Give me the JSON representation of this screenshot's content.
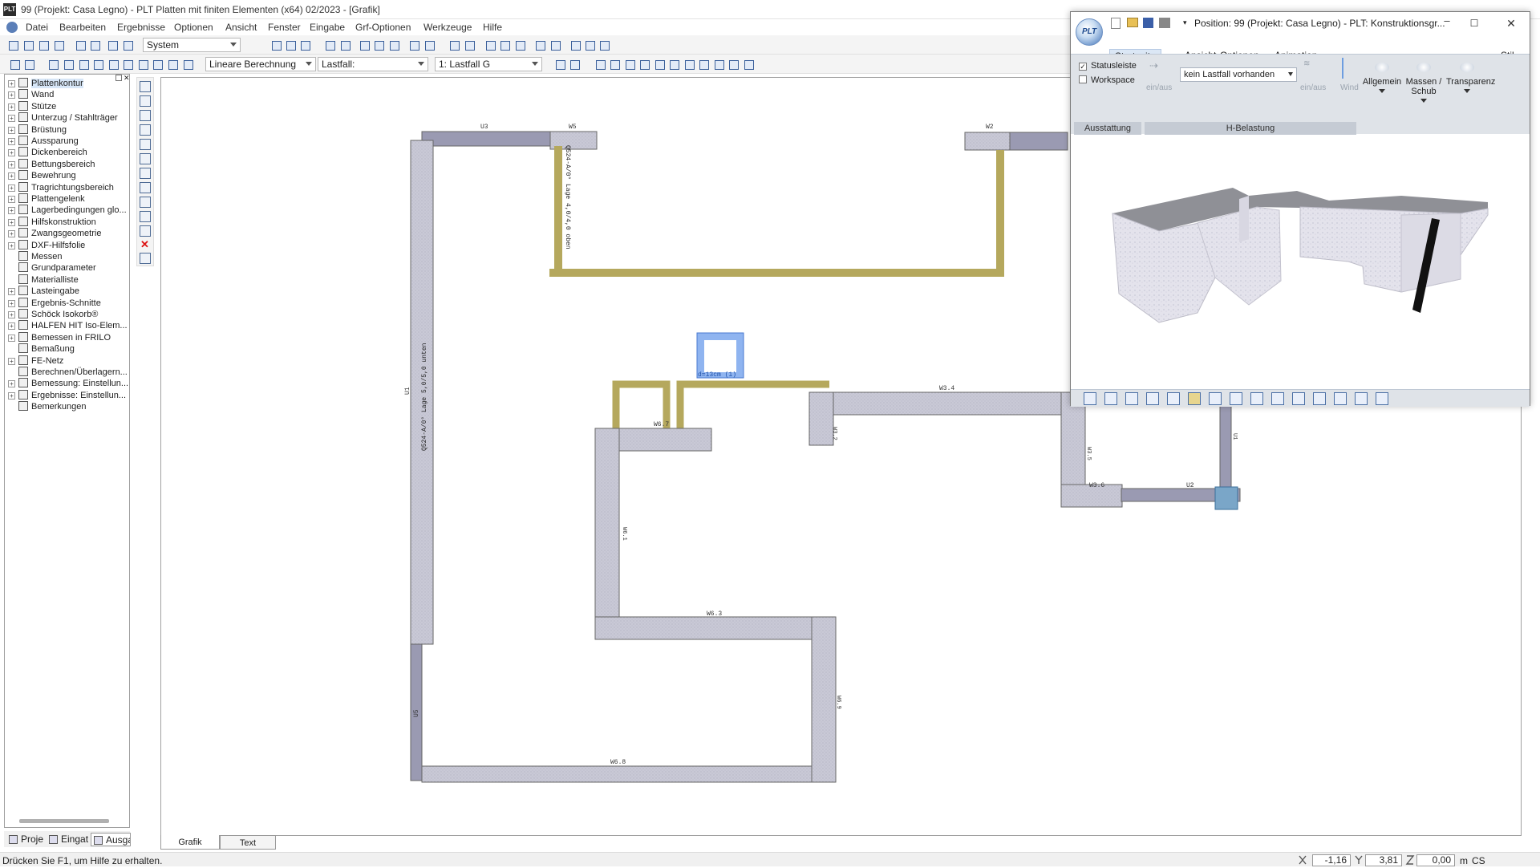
{
  "window": {
    "app_icon": "PLT",
    "title": "99 (Projekt: Casa Legno) - PLT Platten mit finiten Elementen (x64) 02/2023 - [Grafik]"
  },
  "menu": [
    "Datei",
    "Bearbeiten",
    "Ergebnisse",
    "Optionen",
    "Ansicht",
    "Fenster",
    "Eingabe",
    "Grf-Optionen",
    "Werkzeuge",
    "Hilfe"
  ],
  "toolbar1": {
    "system_combo": "System"
  },
  "toolbar2": {
    "calc_combo": "Lineare Berechnung",
    "lastfall_label": "Lastfall:",
    "lastfall_combo": "1: Lastfall G"
  },
  "tree": {
    "items": [
      {
        "label": "Plattenkontur",
        "expandable": true,
        "selected": true
      },
      {
        "label": "Wand",
        "expandable": true
      },
      {
        "label": "Stütze",
        "expandable": true
      },
      {
        "label": "Unterzug / Stahlträger",
        "expandable": true
      },
      {
        "label": "Brüstung",
        "expandable": true
      },
      {
        "label": "Aussparung",
        "expandable": true
      },
      {
        "label": "Dickenbereich",
        "expandable": true
      },
      {
        "label": "Bettungsbereich",
        "expandable": true
      },
      {
        "label": "Bewehrung",
        "expandable": true
      },
      {
        "label": "Tragrichtungsbereich",
        "expandable": true
      },
      {
        "label": "Plattengelenk",
        "expandable": true
      },
      {
        "label": "Lagerbedingungen glo...",
        "expandable": true
      },
      {
        "label": "Hilfskonstruktion",
        "expandable": true
      },
      {
        "label": "Zwangsgeometrie",
        "expandable": true
      },
      {
        "label": "DXF-Hilfsfolie",
        "expandable": true
      },
      {
        "label": "Messen",
        "expandable": false
      },
      {
        "label": "Grundparameter",
        "expandable": false
      },
      {
        "label": "Materialliste",
        "expandable": false
      },
      {
        "label": "Lasteingabe",
        "expandable": true
      },
      {
        "label": "Ergebnis-Schnitte",
        "expandable": true
      },
      {
        "label": "Schöck Isokorb®",
        "expandable": true
      },
      {
        "label": "HALFEN HIT Iso-Elem...",
        "expandable": true
      },
      {
        "label": "Bemessen in FRILO",
        "expandable": true
      },
      {
        "label": "Bemaßung",
        "expandable": false
      },
      {
        "label": "FE-Netz",
        "expandable": true
      },
      {
        "label": "Berechnen/Überlagern...",
        "expandable": false
      },
      {
        "label": "Bemessung: Einstellun...",
        "expandable": true
      },
      {
        "label": "Ergebnisse: Einstellun...",
        "expandable": true
      },
      {
        "label": "Bemerkungen",
        "expandable": false
      }
    ],
    "tabs": [
      "Proje",
      "Eingat",
      "Ausga"
    ]
  },
  "drawing": {
    "labels": {
      "u3": "U3",
      "w5": "W5",
      "w2": "W2",
      "u1": "U1",
      "u5": "U5",
      "w34": "W3.4",
      "w32": "W3.2",
      "w35": "W3.5",
      "w36": "W3.6",
      "u2": "U2",
      "u1r": "U1",
      "w67": "W6.7",
      "w61": "W6.1",
      "w63": "W6.3",
      "w69": "W6.9",
      "w68": "W6.8",
      "rebar_left": "Q524-A/0° Lage 5,0/5,0 unten",
      "rebar_top": "Q524-A/0° Lage 4,0/4,0 oben",
      "column": "d=13cm (1)"
    }
  },
  "bottom_tabs": [
    "Grafik",
    "Text"
  ],
  "status": {
    "help": "Drücken Sie F1, um Hilfe zu erhalten.",
    "x": "-1,16",
    "y": "3,81",
    "z": "0,00",
    "unit": "m",
    "cs": "CS"
  },
  "win3d": {
    "title": "Position: 99 (Projekt: Casa Legno) - PLT: Konstruktionsgr...",
    "tabs": [
      "Startseite",
      "Ansicht",
      "Optionen",
      "Animation"
    ],
    "stil": "Stil",
    "checks": [
      {
        "label": "Statusleiste",
        "checked": true
      },
      {
        "label": "Workspace",
        "checked": false
      }
    ],
    "einaus1": "ein/aus",
    "combo": "kein Lastfall vorhanden",
    "einaus2": "ein/aus",
    "wind": "Wind",
    "group1": "Ausstattung",
    "group2": "H-Belastung",
    "big_buttons": [
      "Allgemein",
      "Massen / Schub",
      "Transparenz"
    ]
  },
  "colors": {
    "wall_fill": "#c9c9d6",
    "beam_fill": "#9a9ab2",
    "rebar_fill": "#b5a85d",
    "column_fill": "#8fb4f0",
    "accent": "#2f64b4"
  }
}
